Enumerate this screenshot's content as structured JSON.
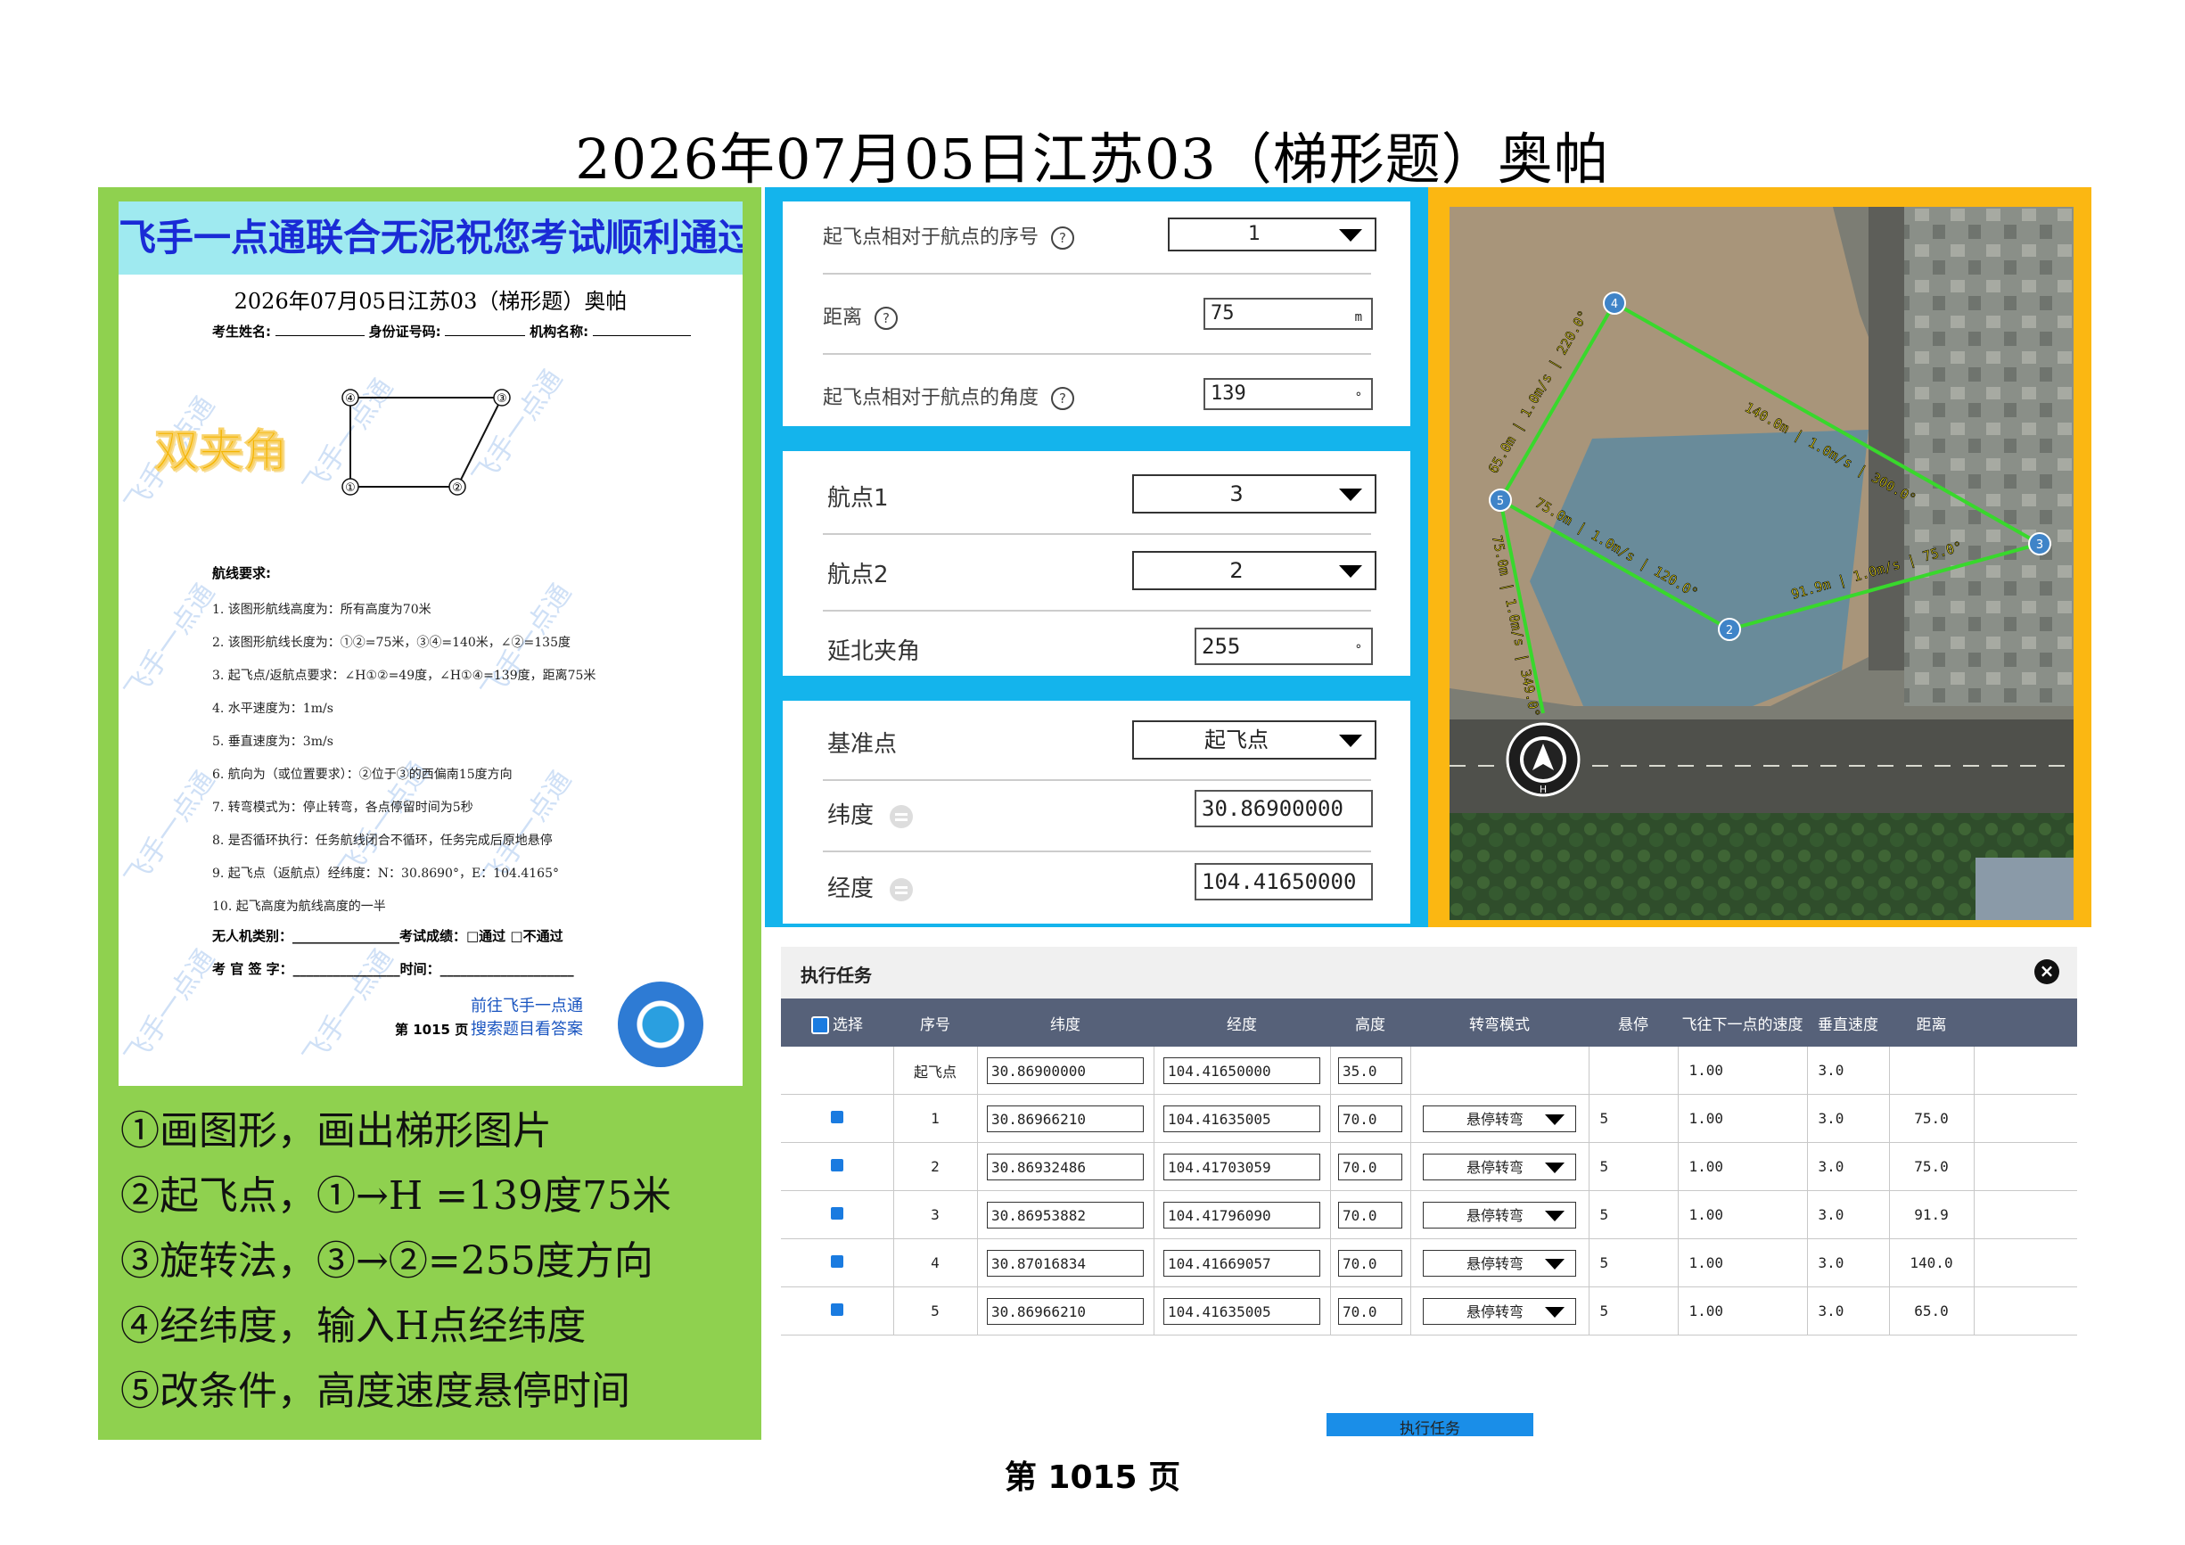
{
  "page": {
    "title": "2026年07月05日江苏03（梯形题）奥帕",
    "footer": "第  1015  页"
  },
  "exam_paper": {
    "banner": "飞手一点通联合无泥祝您考试顺利通过",
    "title": "2026年07月05日江苏03（梯形题）奥帕",
    "info_labels": [
      "考生姓名:",
      "身份证号码:",
      "机构名称:"
    ],
    "badge": "双夹角",
    "point_labels": [
      "④",
      "③",
      "①",
      "②"
    ],
    "requirements_heading": "航线要求:",
    "requirements": [
      "1.  该图形航线高度为：所有高度为70米",
      "2.  该图形航线长度为：①②=75米，③④=140米，∠②=135度",
      "3.  起飞点/返航点要求：∠H①②=49度，∠H①④=139度，距离75米",
      "4.  水平速度为：1m/s",
      "5.  垂直速度为：3m/s",
      "6.  航向为（或位置要求）：②位于③的西偏南15度方向",
      "7.  转弯模式为：停止转弯，各点停留时间为5秒",
      "8.  是否循环执行：任务航线闭合不循环，任务完成后原地悬停",
      "9.  起飞点（返航点）经纬度：N：30.8690°，E：104.4165°",
      "10. 起飞高度为航线高度的一半"
    ],
    "sign_lines": [
      "无人机类别：________________考试成绩：□通过   □不通过",
      "考 官 签 字：________________时间：____________________"
    ],
    "goto_text": [
      "前往飞手一点通",
      "搜索题目看答案"
    ],
    "page_label": "第 1015 页",
    "watermark": "飞手一点通"
  },
  "steps": [
    "①画图形，画出梯形图片",
    "②起飞点，①→H =139度75米",
    "③旋转法，③→②=255度方向",
    "④经纬度，输入H点经纬度",
    "⑤改条件，高度速度悬停时间"
  ],
  "takeoff_card": {
    "seq_label": "起飞点相对于航点的序号",
    "seq_value": "1",
    "distance_label": "距离",
    "distance_value": "75",
    "distance_unit": "m",
    "angle_label": "起飞点相对于航点的角度",
    "angle_value": "139",
    "angle_unit": "°",
    "help_icon": "?"
  },
  "rotate_card": {
    "wp1_label": "航点1",
    "wp1_value": "3",
    "wp2_label": "航点2",
    "wp2_value": "2",
    "north_label": "延北夹角",
    "north_value": "255",
    "north_unit": "°"
  },
  "coord_card": {
    "ref_label": "基准点",
    "ref_value": "起飞点",
    "lat_label": "纬度",
    "lat_value": "30.86900000",
    "lng_label": "经度",
    "lng_value": "104.41650000"
  },
  "map": {
    "waypoint_labels": [
      "1",
      "2",
      "3",
      "4",
      "5"
    ],
    "segment_labels": [
      "140.0m | 1.0m/s | 300.0°",
      "91.9m | 1.0m/s | 75.0°",
      "75.0m | 1.0m/s | 120.0°",
      "65.0m | 1.0m/s | 220.0°",
      "75.0m | 1.0m/s | 349.0°"
    ],
    "home_label": "H",
    "colors": {
      "route": "#38d82c",
      "waypoint": "#3f84c8",
      "label": "#f3e21a"
    }
  },
  "task_panel": {
    "title": "执行任务",
    "close_icon": "×",
    "select_label": "选择",
    "columns": [
      "序号",
      "纬度",
      "经度",
      "高度",
      "转弯模式",
      "悬停",
      "飞往下一点的速度",
      "垂直速度",
      "距离"
    ],
    "takeoff_row": {
      "seq": "起飞点",
      "lat": "30.86900000",
      "lng": "104.41650000",
      "alt": "35.0",
      "speed": "1.00",
      "vspeed": "3.0"
    },
    "rows": [
      {
        "seq": "1",
        "lat": "30.86966210",
        "lng": "104.41635005",
        "alt": "70.0",
        "turn": "悬停转弯",
        "hover": "5",
        "speed": "1.00",
        "vspeed": "3.0",
        "dist": "75.0"
      },
      {
        "seq": "2",
        "lat": "30.86932486",
        "lng": "104.41703059",
        "alt": "70.0",
        "turn": "悬停转弯",
        "hover": "5",
        "speed": "1.00",
        "vspeed": "3.0",
        "dist": "75.0"
      },
      {
        "seq": "3",
        "lat": "30.86953882",
        "lng": "104.41796090",
        "alt": "70.0",
        "turn": "悬停转弯",
        "hover": "5",
        "speed": "1.00",
        "vspeed": "3.0",
        "dist": "91.9"
      },
      {
        "seq": "4",
        "lat": "30.87016834",
        "lng": "104.41669057",
        "alt": "70.0",
        "turn": "悬停转弯",
        "hover": "5",
        "speed": "1.00",
        "vspeed": "3.0",
        "dist": "140.0"
      },
      {
        "seq": "5",
        "lat": "30.86966210",
        "lng": "104.41635005",
        "alt": "70.0",
        "turn": "悬停转弯",
        "hover": "5",
        "speed": "1.00",
        "vspeed": "3.0",
        "dist": "65.0"
      }
    ],
    "execute_label": "执行任务"
  }
}
